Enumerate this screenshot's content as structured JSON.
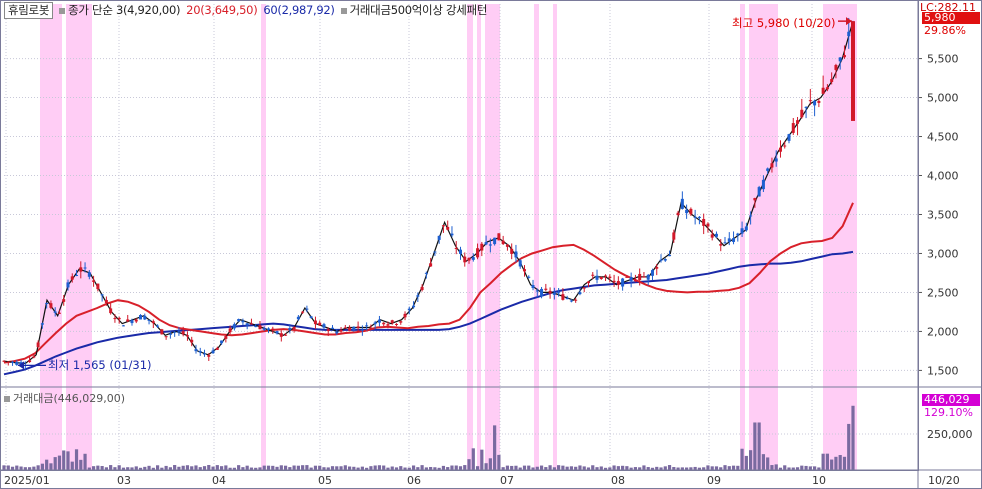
{
  "legend": {
    "ticker": "휴림로봇",
    "ma3": "종가 단순 3(4,920,00)",
    "ma20": "20(3,649,50)",
    "ma60": "60(2,987,92)",
    "pattern": "거래대금500억이상 강세패턴",
    "vol_legend": "거래대금(446,029,00)",
    "lc": "LC:282.11"
  },
  "tags": {
    "price": "5,980",
    "price_pct": "29.86%",
    "vol": "446,029",
    "vol_pct": "129.10%"
  },
  "annotations": {
    "high": "최고 5,980 (10/20)",
    "low": "최저 1,565 (01/31)"
  },
  "colors": {
    "up": "#d2182a",
    "down": "#1e5fd0",
    "ma3": "#111111",
    "ma20": "#d8202a",
    "ma60": "#1a2aa8",
    "highlight": "#ffcdf5",
    "volume": "#7a6aa0"
  },
  "chart_data": {
    "type": "line",
    "title": "",
    "x_ticks": [
      "2025/01",
      "03",
      "04",
      "05",
      "06",
      "07",
      "08",
      "09",
      "10",
      "10/20"
    ],
    "y_ticks": [
      1500,
      2000,
      2500,
      3000,
      3500,
      4000,
      4500,
      5000,
      5500
    ],
    "y_tick_labels": [
      "1,500",
      "2,000",
      "2,500",
      "3,000",
      "3,500",
      "4,000",
      "4,500",
      "5,000",
      "5,500"
    ],
    "ylim": [
      1300,
      6200
    ],
    "volume_ticks": [
      250000
    ],
    "volume_tick_labels": [
      "250,000"
    ],
    "volume_ylim": [
      0,
      500000
    ],
    "series": [
      {
        "name": "20",
        "values": [
          1600,
          1620,
          1650,
          1720,
          1850,
          1980,
          2100,
          2200,
          2250,
          2300,
          2360,
          2400,
          2380,
          2330,
          2250,
          2150,
          2080,
          2040,
          2020,
          2000,
          1980,
          1960,
          1950,
          1960,
          1980,
          2000,
          2020,
          2030,
          2020,
          2000,
          1980,
          1960,
          1960,
          1980,
          1990,
          2010,
          2050,
          2060,
          2050,
          2040,
          2060,
          2070,
          2090,
          2100,
          2150,
          2300,
          2500,
          2620,
          2750,
          2850,
          2940,
          3000,
          3040,
          3080,
          3100,
          3110,
          3050,
          2970,
          2880,
          2790,
          2720,
          2660,
          2600,
          2550,
          2520,
          2510,
          2500,
          2510,
          2510,
          2520,
          2530,
          2560,
          2620,
          2750,
          2900,
          3000,
          3080,
          3130,
          3150,
          3160,
          3200,
          3350,
          3650
        ]
      },
      {
        "name": "60",
        "values": [
          1450,
          1480,
          1510,
          1560,
          1620,
          1680,
          1730,
          1780,
          1820,
          1860,
          1890,
          1920,
          1940,
          1960,
          1980,
          1990,
          2000,
          2010,
          2020,
          2030,
          2040,
          2050,
          2060,
          2070,
          2080,
          2090,
          2100,
          2090,
          2070,
          2050,
          2030,
          2020,
          2020,
          2020,
          2020,
          2020,
          2020,
          2020,
          2020,
          2020,
          2020,
          2020,
          2020,
          2030,
          2060,
          2100,
          2160,
          2220,
          2280,
          2330,
          2380,
          2420,
          2460,
          2500,
          2530,
          2550,
          2570,
          2590,
          2600,
          2610,
          2620,
          2630,
          2640,
          2650,
          2660,
          2680,
          2700,
          2720,
          2740,
          2770,
          2800,
          2830,
          2850,
          2860,
          2870,
          2870,
          2880,
          2900,
          2930,
          2960,
          2990,
          3000,
          3020
        ]
      },
      {
        "name": "3",
        "values": [
          1620,
          1600,
          1590,
          1700,
          2400,
          2200,
          2600,
          2800,
          2750,
          2500,
          2250,
          2100,
          2150,
          2200,
          2100,
          1950,
          2000,
          1950,
          1750,
          1700,
          1800,
          2000,
          2150,
          2100,
          2050,
          2000,
          1950,
          2050,
          2300,
          2100,
          2050,
          2000,
          2050,
          2050,
          2050,
          2150,
          2100,
          2150,
          2300,
          2600,
          3000,
          3400,
          3100,
          2900,
          3000,
          3150,
          3200,
          3100,
          2900,
          2600,
          2500,
          2500,
          2450,
          2400,
          2600,
          2700,
          2700,
          2600,
          2650,
          2700,
          2700,
          2900,
          3000,
          3650,
          3500,
          3400,
          3250,
          3100,
          3200,
          3300,
          3700,
          4000,
          4300,
          4500,
          4700,
          4920,
          5000,
          5200,
          5500,
          5980
        ]
      }
    ],
    "annotations": [
      "최고 5,980 (10/20)",
      "최저 1,565 (01/31)"
    ]
  }
}
